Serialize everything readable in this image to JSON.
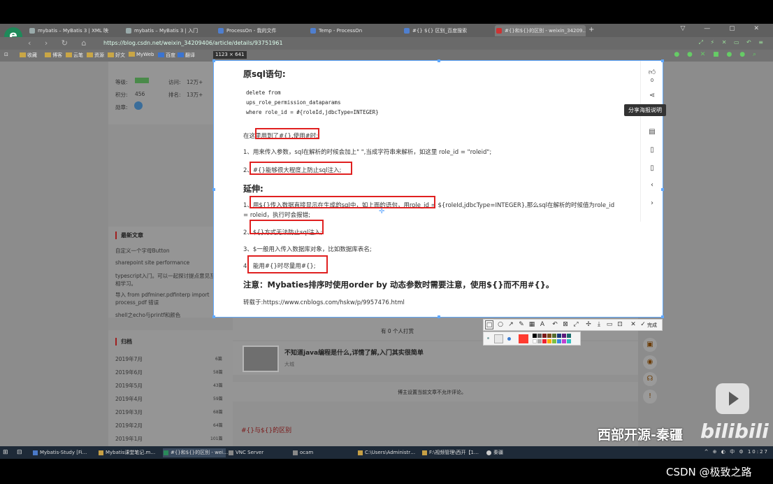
{
  "browser": {
    "tabs": [
      {
        "label": "mybatis – MyBatis 3 | XML 映"
      },
      {
        "label": "mybatis – MyBatis 3 | 入门"
      },
      {
        "label": "ProcessOn - 我的文件"
      },
      {
        "label": "Temp - ProcessOn"
      },
      {
        "label": "#{} ${} 区别_百度搜索"
      },
      {
        "label": "#{}和${}的区别 - weixin_34209…"
      }
    ],
    "url": "https://blog.csdn.net/weixin_34209406/article/details/93751961",
    "bookmarks": [
      "收藏",
      "博客",
      "云笔",
      "资源",
      "好文",
      "MyWeb",
      "百度",
      "翻译"
    ],
    "window_controls": "▽ — ▢ ✕"
  },
  "sidebar": {
    "stats": {
      "level_label": "等级:",
      "visits_label": "访问:",
      "visits": "12万+",
      "points_label": "积分:",
      "points": "456",
      "rank_label": "排名:",
      "rank": "13万+",
      "badge_label": "勋章:"
    },
    "latest_title": "最新文章",
    "latest_articles": [
      "自定义一个字母Button",
      "sharepoint site performance",
      "typescript入门。可以一起探讨提点意见互相学习。",
      "导入 from pdfminer.pdfinterp import process_pdf 错误",
      "shell之echo与printf和颜色"
    ],
    "archive_title": "归档",
    "archive": [
      {
        "month": "2019年7月",
        "count": "6篇"
      },
      {
        "month": "2019年6月",
        "count": "58篇"
      },
      {
        "month": "2019年5月",
        "count": "43篇"
      },
      {
        "month": "2019年4月",
        "count": "59篇"
      },
      {
        "month": "2019年3月",
        "count": "68篇"
      },
      {
        "month": "2019年2月",
        "count": "64篇"
      },
      {
        "month": "2019年1月",
        "count": "101篇"
      }
    ]
  },
  "capture": {
    "size_label": "1123 × 641",
    "heading1": "原sql语句:",
    "code_lines": [
      "delete from",
      "ups_role_permission_dataparams",
      "where role_id = #{roleId,jdbcType=INTEGER}"
    ],
    "p1": "在这里用到了#{},使用#时:",
    "p2": "1、用来传入参数，sql在解析的时候会加上\" \",当成字符串来解析，如这里 role_id = \"roleid\";",
    "p3": "2、#{}能够很大程度上防止sql注入;",
    "heading2": "延伸:",
    "p4a": "1、用${}传入数据直接显示在生成的sql中，如上面的语句，用role_id = ${roleId,jdbcType=INTEGER},那么sql在解析的时候值为role_id",
    "p4b": "= roleid，执行时会报错;",
    "p5": "2、${}方式无法防止sql注入;",
    "p6": "3、$一般用入传入数据库对象，比如数据库表名;",
    "p7": "4、能用#{}时尽量用#{};",
    "note": "注意：Mybaties排序时使用order by 动态参数时需要注意，使用${}而不用#{}。",
    "source": "转载于:https://www.cnblogs.com/hskw/p/9957476.html",
    "like_count": "0",
    "tooltip": "分享海报说明"
  },
  "toolbar": {
    "done_label": "完成"
  },
  "below": {
    "reward_text": "有 0 个人打赏",
    "ad_title": "不知道java编程是什么,详情了解,入门其实很简单",
    "ad_sub": "大城",
    "comment_notice": "博主设置当前文章不允许评论。",
    "related_link": "#{}与${}的区别"
  },
  "taskbar": {
    "items": [
      "Mybatis-Study [Fi…",
      "Mybatis课堂笔记.m…",
      "#{}和${}的区别 - wei…",
      "VNC Server",
      "ocam",
      "C:\\Users\\Administr…",
      "F:\\视频管理\\西开【1…",
      "秦疆"
    ],
    "tray": "^ ⊕ ◐ 中 ⚙ 10:27"
  },
  "watermarks": {
    "channel": "西部开源-秦疆",
    "bilibili": "bilibili",
    "csdn": "CSDN @极致之路"
  }
}
